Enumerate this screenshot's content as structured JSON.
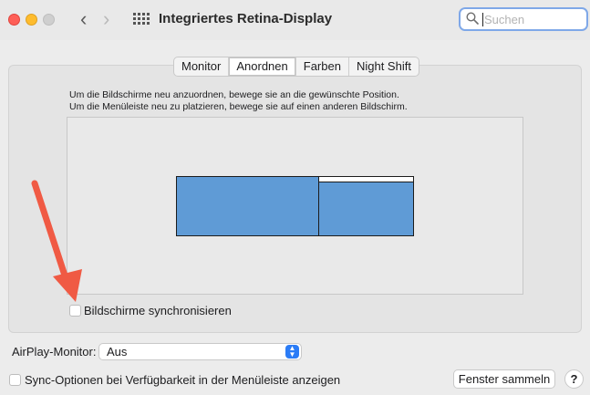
{
  "window": {
    "title": "Integriertes Retina-Display"
  },
  "toolbar": {
    "back_icon": "chevron-left",
    "forward_icon": "chevron-right",
    "grid_icon": "all-preferences-grid",
    "back_glyph": "‹",
    "forward_glyph": "›"
  },
  "search": {
    "placeholder": "Suchen",
    "value": ""
  },
  "tabs": [
    {
      "label": "Monitor",
      "selected": false
    },
    {
      "label": "Anordnen",
      "selected": true
    },
    {
      "label": "Farben",
      "selected": false
    },
    {
      "label": "Night Shift",
      "selected": false
    }
  ],
  "instructions": {
    "line1": "Um die Bildschirme neu anzuordnen, bewege sie an die gewünschte Position.",
    "line2": "Um die Menüleiste neu zu platzieren, bewege sie auf einen anderen Bildschirm."
  },
  "mirror": {
    "label": "Bildschirme synchronisieren",
    "checked": false
  },
  "airplay": {
    "label": "AirPlay-Monitor:",
    "value": "Aus"
  },
  "sync_options": {
    "label": "Sync-Optionen bei Verfügbarkeit in der Menüleiste anzeigen",
    "checked": false
  },
  "gather_button": {
    "label": "Fenster sammeln"
  },
  "help_button": {
    "label": "?"
  },
  "colors": {
    "display_fill": "#5f9bd6",
    "accent": "#2b7cf6",
    "annotation_arrow": "#f05a44"
  }
}
